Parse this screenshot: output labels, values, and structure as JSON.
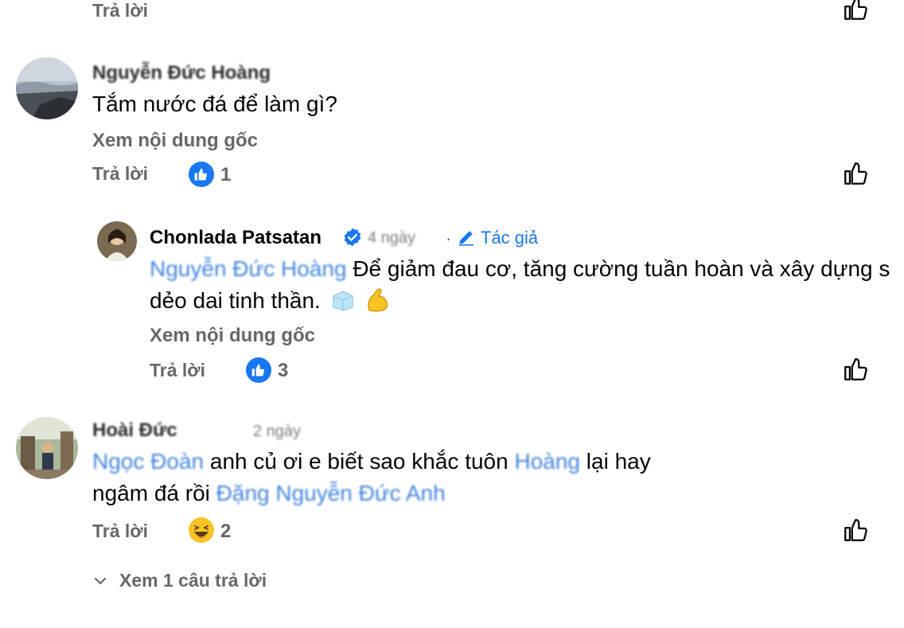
{
  "actions": {
    "reply_label": "Trả lời"
  },
  "comments": [
    {
      "author": "Nguyễn Đức Hoàng",
      "text": "Tắm nước đá để làm gì?",
      "see_original": "Xem nội dung gốc",
      "reaction_count": "1"
    },
    {
      "author": "Chonlada Patsatan",
      "time": "4 ngày",
      "author_badge": "Tác giả",
      "mention": "Nguyễn Đức Hoàng",
      "text_line1": "Để giảm đau cơ, tăng cường tuần hoàn và xây dựng s",
      "text_line2": "dẻo dai tinh thần.",
      "see_original": "Xem nội dung gốc",
      "reaction_count": "3"
    },
    {
      "author": "Hoài Đức",
      "time": "2 ngày",
      "mention_start": "Ngọc Đoàn",
      "text_a": "anh củ ơi e biết sao khắc tuôn",
      "mention_mid": "Hoàng",
      "text_b": "lại hay",
      "text_c": "ngâm đá rồi",
      "mention_end": "Đặng Nguyễn Đức Anh",
      "reaction_count": "2",
      "view_replies": "Xem 1 câu trả lời"
    }
  ],
  "colors": {
    "accent": "#1877f2",
    "mention": "#216fdb",
    "muted": "#65676b"
  }
}
